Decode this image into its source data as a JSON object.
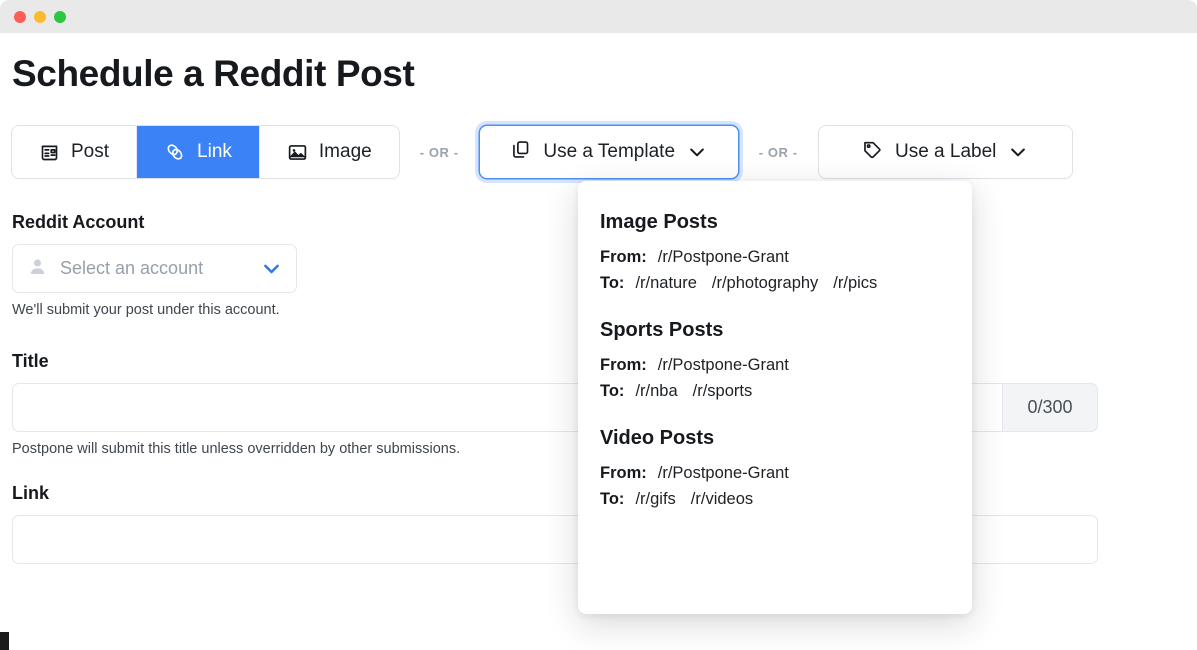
{
  "window": {
    "traffic_lights": [
      "close",
      "minimize",
      "maximize"
    ]
  },
  "header": {
    "title": "Schedule a Reddit Post"
  },
  "source_row": {
    "tabs": [
      {
        "label": "Post",
        "icon": "newspaper-icon",
        "active": false
      },
      {
        "label": "Link",
        "icon": "link-icon",
        "active": true
      },
      {
        "label": "Image",
        "icon": "image-icon",
        "active": false
      }
    ],
    "or_label_1": "- OR -",
    "or_label_2": "- OR -",
    "template_button": {
      "label": "Use a Template",
      "icon": "copy-icon",
      "chevron": "chevron-down-icon",
      "focused": true
    },
    "label_button": {
      "label": "Use a Label",
      "icon": "tag-icon",
      "chevron": "chevron-down-icon",
      "focused": false
    }
  },
  "form": {
    "account": {
      "label": "Reddit Account",
      "placeholder": "Select an account",
      "icon": "user-icon",
      "chevron": "chevron-down-icon",
      "help": "We'll submit your post under this account."
    },
    "title": {
      "label": "Title",
      "value": "",
      "placeholder": "",
      "counter": "0/300",
      "help": "Postpone will submit this title unless overridden by other submissions."
    },
    "link": {
      "label": "Link",
      "value": "",
      "placeholder": ""
    }
  },
  "template_dropdown": {
    "open": true,
    "items": [
      {
        "name": "Image Posts",
        "from_label": "From:",
        "from_value": "/r/Postpone-Grant",
        "to_label": "To:",
        "to_values": [
          "/r/nature",
          "/r/photography",
          "/r/pics"
        ]
      },
      {
        "name": "Sports Posts",
        "from_label": "From:",
        "from_value": "/r/Postpone-Grant",
        "to_label": "To:",
        "to_values": [
          "/r/nba",
          "/r/sports"
        ]
      },
      {
        "name": "Video Posts",
        "from_label": "From:",
        "from_value": "/r/Postpone-Grant",
        "to_label": "To:",
        "to_values": [
          "/r/gifs",
          "/r/videos"
        ]
      }
    ]
  },
  "colors": {
    "accent_blue": "#3b82f6",
    "focus_blue": "#4e8ff5",
    "titlebar": "#e9e9e9",
    "border": "#e4e7eb",
    "muted_text": "#96a0ab"
  }
}
